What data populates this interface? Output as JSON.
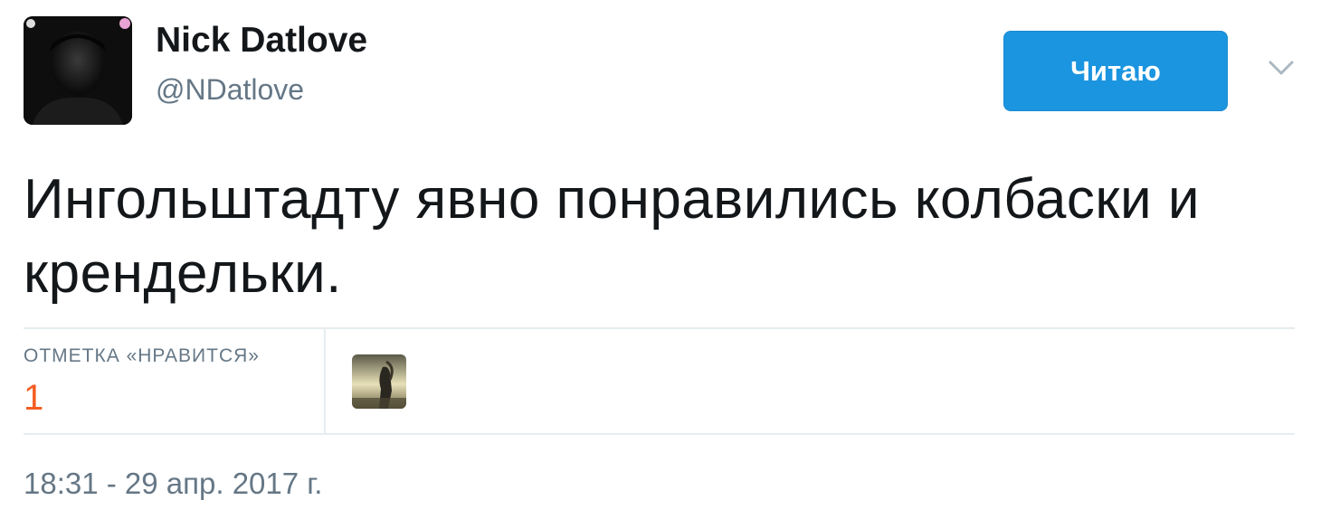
{
  "author": {
    "name": "Nick Datlove",
    "handle": "@NDatlove",
    "avatar_icon": "user-photo-avatar"
  },
  "follow_button": {
    "label": "Читаю",
    "color": "#1b95e0"
  },
  "menu": {
    "icon": "chevron-down-icon"
  },
  "tweet": {
    "text": "Ингольштадту явно понравились колбаски и крендельки."
  },
  "stats": {
    "likes_label": "ОТМЕТКА «НРАВИТСЯ»",
    "likes_count": "1",
    "likes_color": "#f45d22",
    "liker_avatar_icon": "liker-photo-avatar"
  },
  "timestamp": "18:31 - 29 апр. 2017 г."
}
